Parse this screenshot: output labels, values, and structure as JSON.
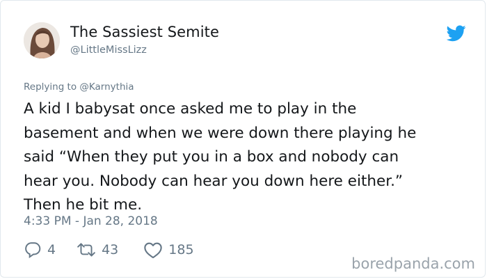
{
  "tweet": {
    "display_name": "The Sassiest Semite",
    "handle": "@LittleMissLizz",
    "replying_to_prefix": "Replying to",
    "replying_to_handle": "@Karnythia",
    "text_lines": [
      "A kid I babysat once asked me to play in the",
      "basement and when we were down there playing he",
      "said “When they put you in a box and nobody can",
      "hear you. Nobody can hear you down here either.”",
      "Then he bit me."
    ],
    "timestamp": "4:33 PM - Jan 28, 2018",
    "reply_count": "4",
    "retweet_count": "43",
    "like_count": "185"
  },
  "icons": {
    "brand": "twitter-bird-icon",
    "reply": "reply-bubble-icon",
    "retweet": "retweet-icon",
    "like": "heart-icon"
  },
  "colors": {
    "brand_blue": "#1da1f2",
    "text": "#14171a",
    "muted": "#657786"
  },
  "watermark": "boredpanda.com"
}
